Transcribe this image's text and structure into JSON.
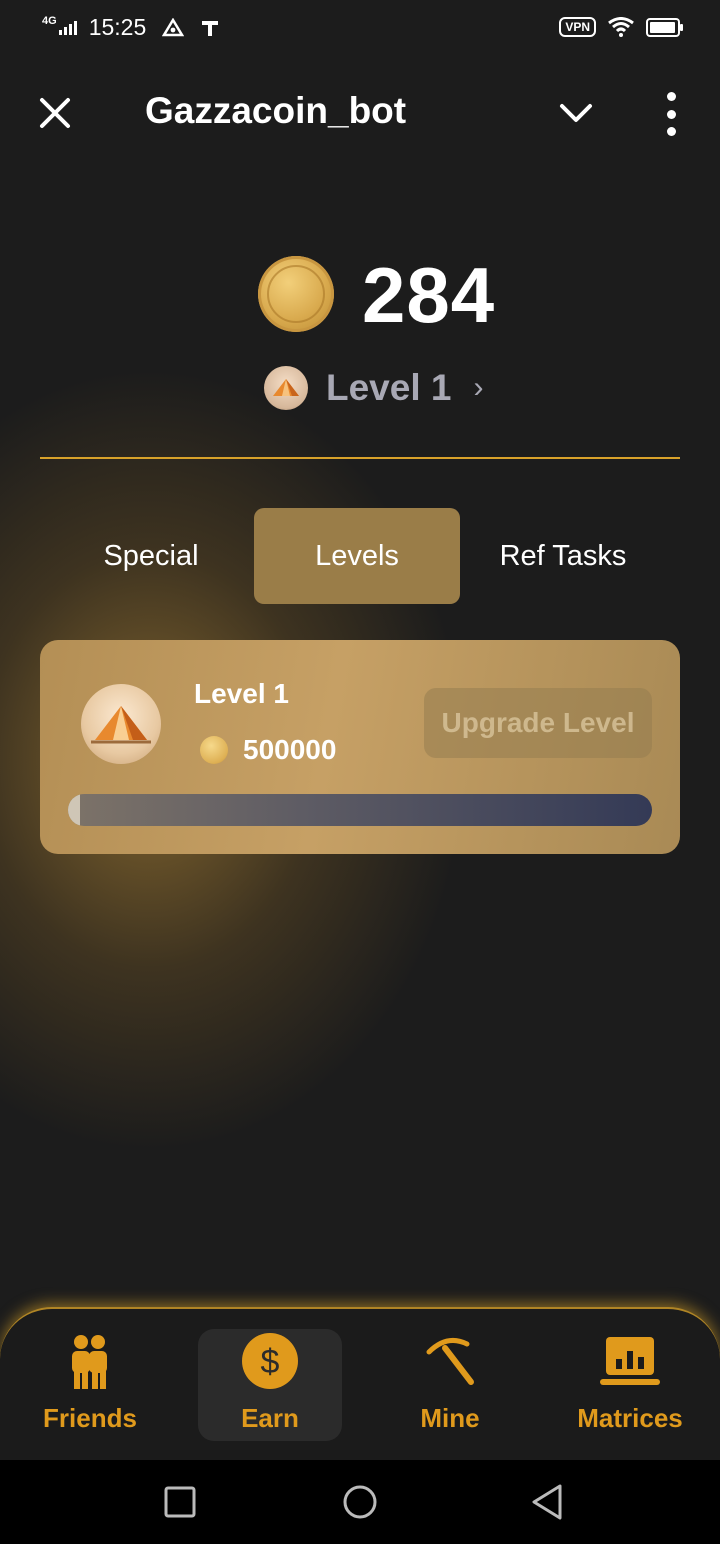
{
  "status_bar": {
    "network": "4G",
    "time": "15:25",
    "vpn": "VPN",
    "icons": [
      "signal-icon",
      "data-saver-icon",
      "carrier-t-icon",
      "wifi-icon",
      "battery-icon"
    ]
  },
  "header": {
    "title": "Gazzacoin_bot",
    "icons": [
      "close-icon",
      "chevron-down-icon",
      "more-vertical-icon"
    ]
  },
  "balance": {
    "value": "284",
    "level_label": "Level 1",
    "level_arrow": "›"
  },
  "tabs": [
    {
      "label": "Special",
      "active": false
    },
    {
      "label": "Levels",
      "active": true
    },
    {
      "label": "Ref Tasks",
      "active": false
    }
  ],
  "level_card": {
    "title": "Level 1",
    "price": "500000",
    "button_label": "Upgrade Level",
    "progress": 0.01
  },
  "bottom_nav": [
    {
      "label": "Friends",
      "icon": "friends-icon",
      "active": false
    },
    {
      "label": "Earn",
      "icon": "dollar-coin-icon",
      "active": true
    },
    {
      "label": "Mine",
      "icon": "pickaxe-icon",
      "active": false
    },
    {
      "label": "Matrices",
      "icon": "chart-laptop-icon",
      "active": false
    }
  ],
  "colors": {
    "accent": "#e09a1c",
    "divider": "#d8a22a",
    "tab_active": "#9a7d48",
    "card": "#c6a065",
    "background": "#1c1c1c"
  }
}
